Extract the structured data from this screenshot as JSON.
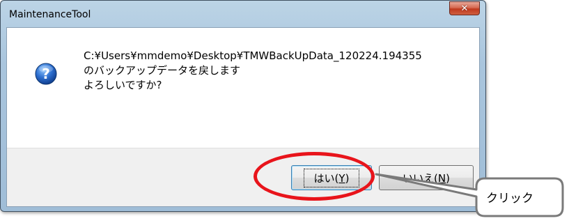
{
  "window": {
    "title": "MaintenanceTool",
    "close_icon": "close-icon"
  },
  "dialog": {
    "icon": "question-icon",
    "message_line1": "C:¥Users¥mmdemo¥Desktop¥TMWBackUpData_120224.194355",
    "message_line2": "のバックアップデータを戻します",
    "message_line3": "よろしいですか?"
  },
  "buttons": {
    "yes_prefix": "はい(",
    "yes_mnemonic": "Y",
    "yes_suffix": ")",
    "no_prefix": "いいえ(",
    "no_mnemonic": "N",
    "no_suffix": ")"
  },
  "annotation": {
    "callout_text": "クリック",
    "highlight_color": "#e8141b"
  }
}
